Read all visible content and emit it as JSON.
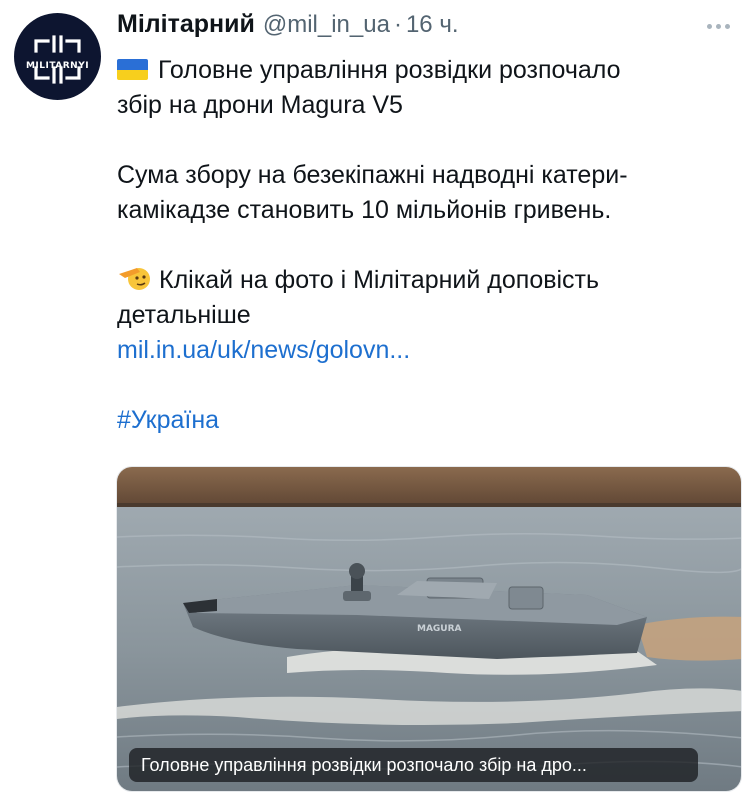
{
  "author": {
    "name": "Мілітарний",
    "handle": "@mil_in_ua",
    "separator": "·",
    "time": "16 ч.",
    "avatar_text": "MILITARNYI"
  },
  "tweet": {
    "line1": "Головне управління розвідки розпочало",
    "line2": "збір на дрони Magura V5",
    "line3": "Сума збору на безекіпажні надводні катери-",
    "line4": "камікадзе становить 10 мільйонів гривень.",
    "line5": "Клікай на фото і Мілітарний доповість",
    "line6": "детальніше",
    "link": "mil.in.ua/uk/news/golovn...",
    "hashtag": "#Україна"
  },
  "media": {
    "caption": "Головне управління розвідки розпочало збір на дро...",
    "boat_label": "MAGURA"
  },
  "icons": {
    "flag": "ukraine-flag-icon",
    "salute": "saluting-face-icon",
    "more": "more-options-icon"
  },
  "colors": {
    "link": "#1d6fcf",
    "secondary_text": "#536471",
    "avatar_bg": "#0d1530"
  }
}
